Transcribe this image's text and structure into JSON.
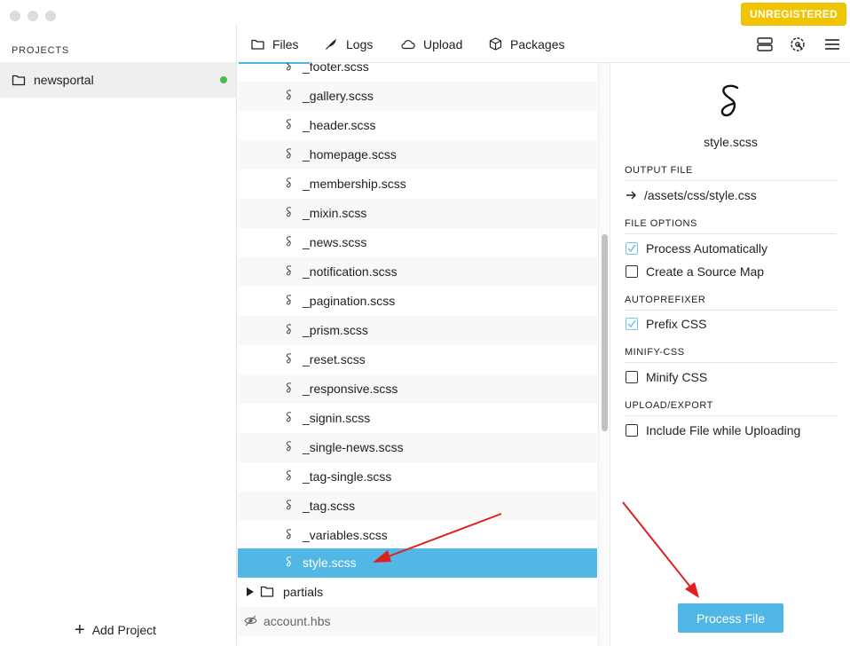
{
  "window": {
    "badge": "UNREGISTERED"
  },
  "sidebar": {
    "heading": "PROJECTS",
    "project": {
      "name": "newsportal",
      "status_color": "#4ab84a"
    },
    "add_label": "Add Project"
  },
  "toolbar": {
    "tabs": [
      {
        "label": "Files",
        "icon": "folder-icon",
        "active": true
      },
      {
        "label": "Logs",
        "icon": "feather-icon"
      },
      {
        "label": "Upload",
        "icon": "cloud-icon"
      },
      {
        "label": "Packages",
        "icon": "package-icon"
      }
    ],
    "right_icons": [
      "server-icon",
      "settings-dial-icon",
      "menu-icon"
    ]
  },
  "files": [
    "_footer.scss",
    "_gallery.scss",
    "_header.scss",
    "_homepage.scss",
    "_membership.scss",
    "_mixin.scss",
    "_news.scss",
    "_notification.scss",
    "_pagination.scss",
    "_prism.scss",
    "_reset.scss",
    "_responsive.scss",
    "_signin.scss",
    "_single-news.scss",
    "_tag-single.scss",
    "_tag.scss",
    "_variables.scss",
    "style.scss"
  ],
  "selected_file": "style.scss",
  "folder": {
    "name": "partials"
  },
  "hidden_file": {
    "name": "account.hbs"
  },
  "detail": {
    "filename": "style.scss",
    "output_file_heading": "OUTPUT FILE",
    "output_path": "/assets/css/style.css",
    "file_options_heading": "FILE OPTIONS",
    "process_auto": {
      "label": "Process Automatically",
      "checked": true
    },
    "source_map": {
      "label": "Create a Source Map",
      "checked": false
    },
    "autoprefixer_heading": "AUTOPREFIXER",
    "prefix_css": {
      "label": "Prefix CSS",
      "checked": true
    },
    "minify_heading": "MINIFY-CSS",
    "minify_css": {
      "label": "Minify CSS",
      "checked": false
    },
    "upload_heading": "UPLOAD/EXPORT",
    "include_upload": {
      "label": "Include File while Uploading",
      "checked": false
    },
    "process_button": "Process File"
  },
  "colors": {
    "accent": "#52b7e4",
    "badge": "#f0c400",
    "annotation": "#e02020"
  }
}
